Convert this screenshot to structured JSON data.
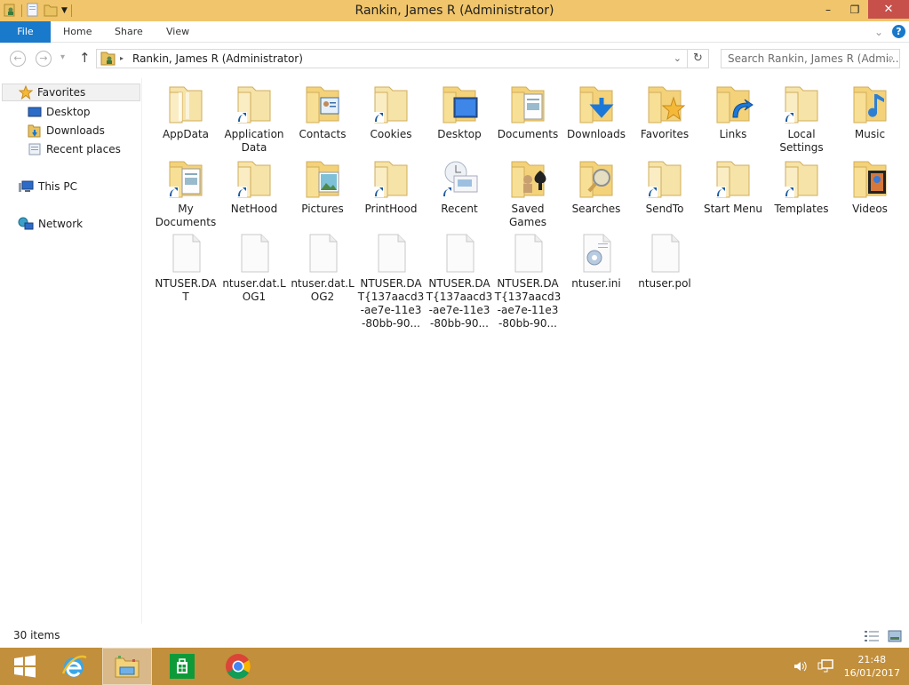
{
  "window": {
    "title": "Rankin, James R (Administrator)",
    "controls": {
      "minimize": "–",
      "restore": "❐",
      "close": "✕"
    }
  },
  "ribbon": {
    "tabs": [
      {
        "label": "File"
      },
      {
        "label": "Home"
      },
      {
        "label": "Share"
      },
      {
        "label": "View"
      }
    ],
    "expand_icon": "⌄",
    "help_icon": "?"
  },
  "navigation": {
    "back": "←",
    "forward": "→",
    "recent_dropdown": "▾",
    "up": "↑",
    "address": {
      "breadcrumb_separator": "▸",
      "crumb": "Rankin, James R (Administrator)",
      "dropdown": "⌄",
      "refresh": "↻"
    },
    "search": {
      "placeholder": "Search Rankin, James R (Admi...",
      "icon": "⌕"
    }
  },
  "sidebar": {
    "favorites": {
      "label": "Favorites",
      "items": [
        {
          "label": "Desktop",
          "icon": "desktop"
        },
        {
          "label": "Downloads",
          "icon": "downloads"
        },
        {
          "label": "Recent places",
          "icon": "recent-places"
        }
      ]
    },
    "this_pc": {
      "label": "This PC"
    },
    "network": {
      "label": "Network"
    }
  },
  "items": [
    {
      "label": "AppData",
      "type": "folder",
      "shortcut": false,
      "overlay": "none"
    },
    {
      "label": "Application Data",
      "type": "folder",
      "shortcut": true,
      "overlay": "none"
    },
    {
      "label": "Contacts",
      "type": "folder",
      "shortcut": false,
      "overlay": "contacts"
    },
    {
      "label": "Cookies",
      "type": "folder",
      "shortcut": true,
      "overlay": "none"
    },
    {
      "label": "Desktop",
      "type": "folder",
      "shortcut": false,
      "overlay": "desktop"
    },
    {
      "label": "Documents",
      "type": "folder",
      "shortcut": false,
      "overlay": "documents"
    },
    {
      "label": "Downloads",
      "type": "folder",
      "shortcut": false,
      "overlay": "downloads"
    },
    {
      "label": "Favorites",
      "type": "folder",
      "shortcut": false,
      "overlay": "favorites"
    },
    {
      "label": "Links",
      "type": "folder",
      "shortcut": false,
      "overlay": "links"
    },
    {
      "label": "Local Settings",
      "type": "folder",
      "shortcut": true,
      "overlay": "none"
    },
    {
      "label": "Music",
      "type": "folder",
      "shortcut": false,
      "overlay": "music"
    },
    {
      "label": "My Documents",
      "type": "folder",
      "shortcut": true,
      "overlay": "documents"
    },
    {
      "label": "NetHood",
      "type": "folder",
      "shortcut": true,
      "overlay": "none"
    },
    {
      "label": "Pictures",
      "type": "folder",
      "shortcut": false,
      "overlay": "pictures"
    },
    {
      "label": "PrintHood",
      "type": "folder",
      "shortcut": true,
      "overlay": "none"
    },
    {
      "label": "Recent",
      "type": "recent",
      "shortcut": true,
      "overlay": "recent"
    },
    {
      "label": "Saved Games",
      "type": "folder",
      "shortcut": false,
      "overlay": "games"
    },
    {
      "label": "Searches",
      "type": "folder",
      "shortcut": false,
      "overlay": "searches"
    },
    {
      "label": "SendTo",
      "type": "folder",
      "shortcut": true,
      "overlay": "none"
    },
    {
      "label": "Start Menu",
      "type": "folder",
      "shortcut": true,
      "overlay": "none"
    },
    {
      "label": "Templates",
      "type": "folder",
      "shortcut": true,
      "overlay": "none"
    },
    {
      "label": "Videos",
      "type": "folder",
      "shortcut": false,
      "overlay": "videos"
    },
    {
      "label": "NTUSER.DA T",
      "type": "file",
      "shortcut": false,
      "overlay": "none"
    },
    {
      "label": "ntuser.dat.L OG1",
      "type": "file",
      "shortcut": false,
      "overlay": "none"
    },
    {
      "label": "ntuser.dat.L OG2",
      "type": "file",
      "shortcut": false,
      "overlay": "none"
    },
    {
      "label": "NTUSER.DA T{137aacd3 -ae7e-11e3 -80bb-90...",
      "type": "file",
      "shortcut": false,
      "overlay": "none"
    },
    {
      "label": "NTUSER.DA T{137aacd3 -ae7e-11e3 -80bb-90...",
      "type": "file",
      "shortcut": false,
      "overlay": "none"
    },
    {
      "label": "NTUSER.DA T{137aacd3 -ae7e-11e3 -80bb-90...",
      "type": "file",
      "shortcut": false,
      "overlay": "none"
    },
    {
      "label": "ntuser.ini",
      "type": "config",
      "shortcut": false,
      "overlay": "none"
    },
    {
      "label": "ntuser.pol",
      "type": "file",
      "shortcut": false,
      "overlay": "none"
    }
  ],
  "status": {
    "item_count": "30 items"
  },
  "taskbar": {
    "apps": [
      {
        "name": "start",
        "active": false
      },
      {
        "name": "internet-explorer",
        "active": false
      },
      {
        "name": "file-explorer",
        "active": true
      },
      {
        "name": "store",
        "active": false
      },
      {
        "name": "chrome",
        "active": false
      }
    ],
    "clock": {
      "time": "21:48",
      "date": "16/01/2017"
    }
  },
  "colors": {
    "titlebar": "#f0c56b",
    "file_tab": "#1979ca",
    "close": "#c7504a",
    "taskbar": "#c28f3c",
    "folder": "#f3d27a",
    "shortcut_arrow": "#1c5aa0"
  }
}
